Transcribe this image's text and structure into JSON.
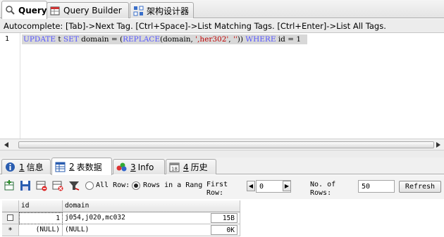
{
  "top_tabs": [
    {
      "label": "Query",
      "icon": "query-icon"
    },
    {
      "label": "Query Builder",
      "icon": "query-builder-icon"
    },
    {
      "label": "架构设计器",
      "icon": "schema-designer-icon"
    }
  ],
  "autocomplete_hint": "Autocomplete: [Tab]->Next Tag. [Ctrl+Space]->List Matching Tags. [Ctrl+Enter]->List All Tags.",
  "editor": {
    "line_number": "1",
    "tokens": [
      {
        "text": "UPDATE",
        "kind": "kw"
      },
      {
        "text": " t ",
        "kind": "plain"
      },
      {
        "text": "SET",
        "kind": "kw"
      },
      {
        "text": " domain = (",
        "kind": "plain"
      },
      {
        "text": "REPLACE",
        "kind": "fn"
      },
      {
        "text": "(domain, ",
        "kind": "plain"
      },
      {
        "text": "',her302'",
        "kind": "str"
      },
      {
        "text": ", ",
        "kind": "plain"
      },
      {
        "text": "''",
        "kind": "str"
      },
      {
        "text": ")) ",
        "kind": "plain"
      },
      {
        "text": "WHERE",
        "kind": "kw"
      },
      {
        "text": " id = 1",
        "kind": "plain"
      }
    ]
  },
  "bottom_tabs": [
    {
      "num": "1",
      "label": "信息",
      "icon": "info-icon"
    },
    {
      "num": "2",
      "label": "表数据",
      "icon": "table-data-icon"
    },
    {
      "num": "3",
      "label": "Info",
      "icon": "tags-info-icon"
    },
    {
      "num": "4",
      "label": "历史",
      "icon": "history-icon"
    }
  ],
  "toolbar": {
    "all_row_label": "All Row:",
    "rows_in_range_label": "Rows in a Rang",
    "first_row_label": [
      "First",
      "Row:"
    ],
    "first_row_value": "0",
    "no_of_rows_label": [
      "No. of",
      "Rows:"
    ],
    "no_of_rows_value": "50",
    "refresh_label": "Refresh"
  },
  "grid": {
    "columns": [
      "id",
      "domain"
    ],
    "rows": [
      {
        "marker": "checkbox",
        "id": "1",
        "domain": "j054,j020,mc032",
        "size": "15B"
      },
      {
        "marker": "*",
        "id": "(NULL)",
        "domain": "(NULL)",
        "size": "0K"
      }
    ]
  },
  "colors": {
    "keyword": "#5555ff",
    "string": "#c00000",
    "selection": "#d8d8d8"
  }
}
